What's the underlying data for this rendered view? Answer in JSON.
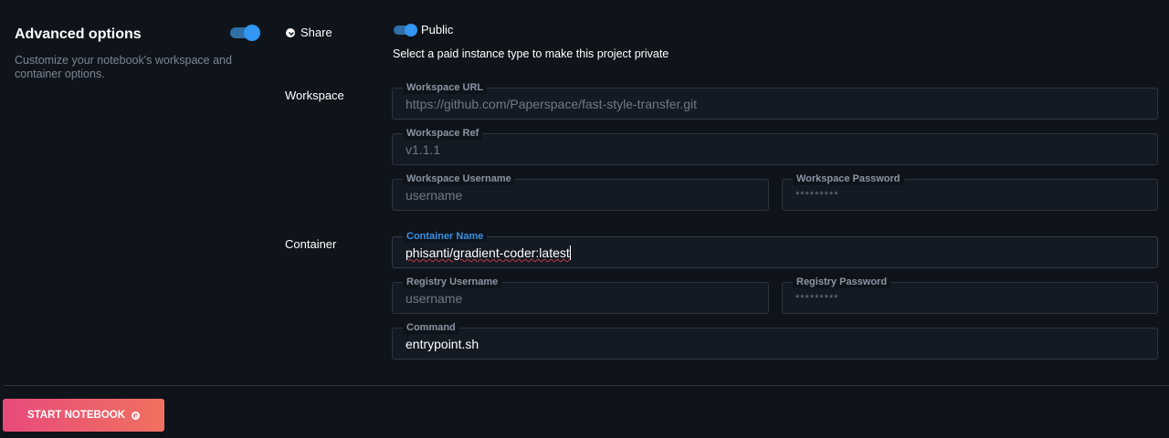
{
  "advanced": {
    "title": "Advanced options",
    "description": "Customize your notebook's workspace and container options.",
    "toggle_on": true
  },
  "share": {
    "label": "Share",
    "toggle_on": true,
    "toggle_label": "Public",
    "note": "Select a paid instance type to make this project private"
  },
  "workspace": {
    "section_label": "Workspace",
    "url": {
      "label": "Workspace URL",
      "placeholder": "https://github.com/Paperspace/fast-style-transfer.git"
    },
    "ref": {
      "label": "Workspace Ref",
      "placeholder": "v1.1.1"
    },
    "username": {
      "label": "Workspace Username",
      "placeholder": "username"
    },
    "password": {
      "label": "Workspace Password",
      "placeholder": "*********"
    }
  },
  "container": {
    "section_label": "Container",
    "name": {
      "label": "Container Name",
      "value": "phisanti/gradient-coder:latest"
    },
    "registry_username": {
      "label": "Registry Username",
      "placeholder": "username"
    },
    "registry_password": {
      "label": "Registry Password",
      "placeholder": "*********"
    },
    "command": {
      "label": "Command",
      "value": "entrypoint.sh"
    }
  },
  "actions": {
    "start_label": "START NOTEBOOK"
  },
  "colors": {
    "background": "#0f141b",
    "accent": "#3396f3",
    "button_gradient_start": "#e84a7b",
    "button_gradient_end": "#f07160"
  }
}
